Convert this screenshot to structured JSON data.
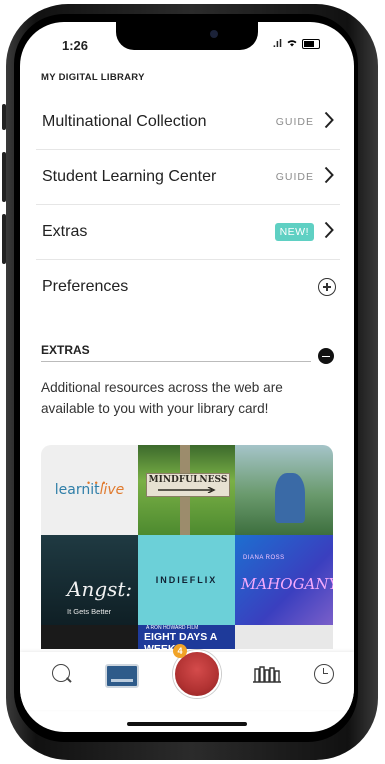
{
  "status_bar": {
    "time": "1:26",
    "signal": ".ıl"
  },
  "header": {
    "section_title": "MY DIGITAL LIBRARY"
  },
  "menu": [
    {
      "label": "Multinational Collection",
      "tag": "GUIDE"
    },
    {
      "label": "Student Learning Center",
      "tag": "GUIDE"
    },
    {
      "label": "Extras",
      "badge": "NEW!"
    },
    {
      "label": "Preferences"
    }
  ],
  "extras": {
    "heading": "EXTRAS",
    "description": "Additional resources across the web are available to you with your library card!"
  },
  "tiles": {
    "learnit": "learnit",
    "learnit_live": "live",
    "mindfulness": "MINDFULNESS",
    "indieflix": "INDIEFLIX",
    "mahogany_name": "DIANA ROSS",
    "mahogany_title": "MAHOGANY",
    "angst_title": "Angst:",
    "angst_sub": "It Gets Better",
    "eight_small": "A RON HOWARD FILM",
    "eight_title": "EIGHT DAYS A WEEK"
  },
  "tabbar": {
    "badge_count": "4"
  },
  "colors": {
    "accent_new": "#5fd0c3",
    "badge": "#f0a328",
    "avatar": "#b13232"
  },
  "icons": [
    "search-icon",
    "library-card-icon",
    "avatar-icon",
    "shelf-icon",
    "clock-icon",
    "chevron-right-icon",
    "plus-circle-icon",
    "minus-circle-icon"
  ]
}
